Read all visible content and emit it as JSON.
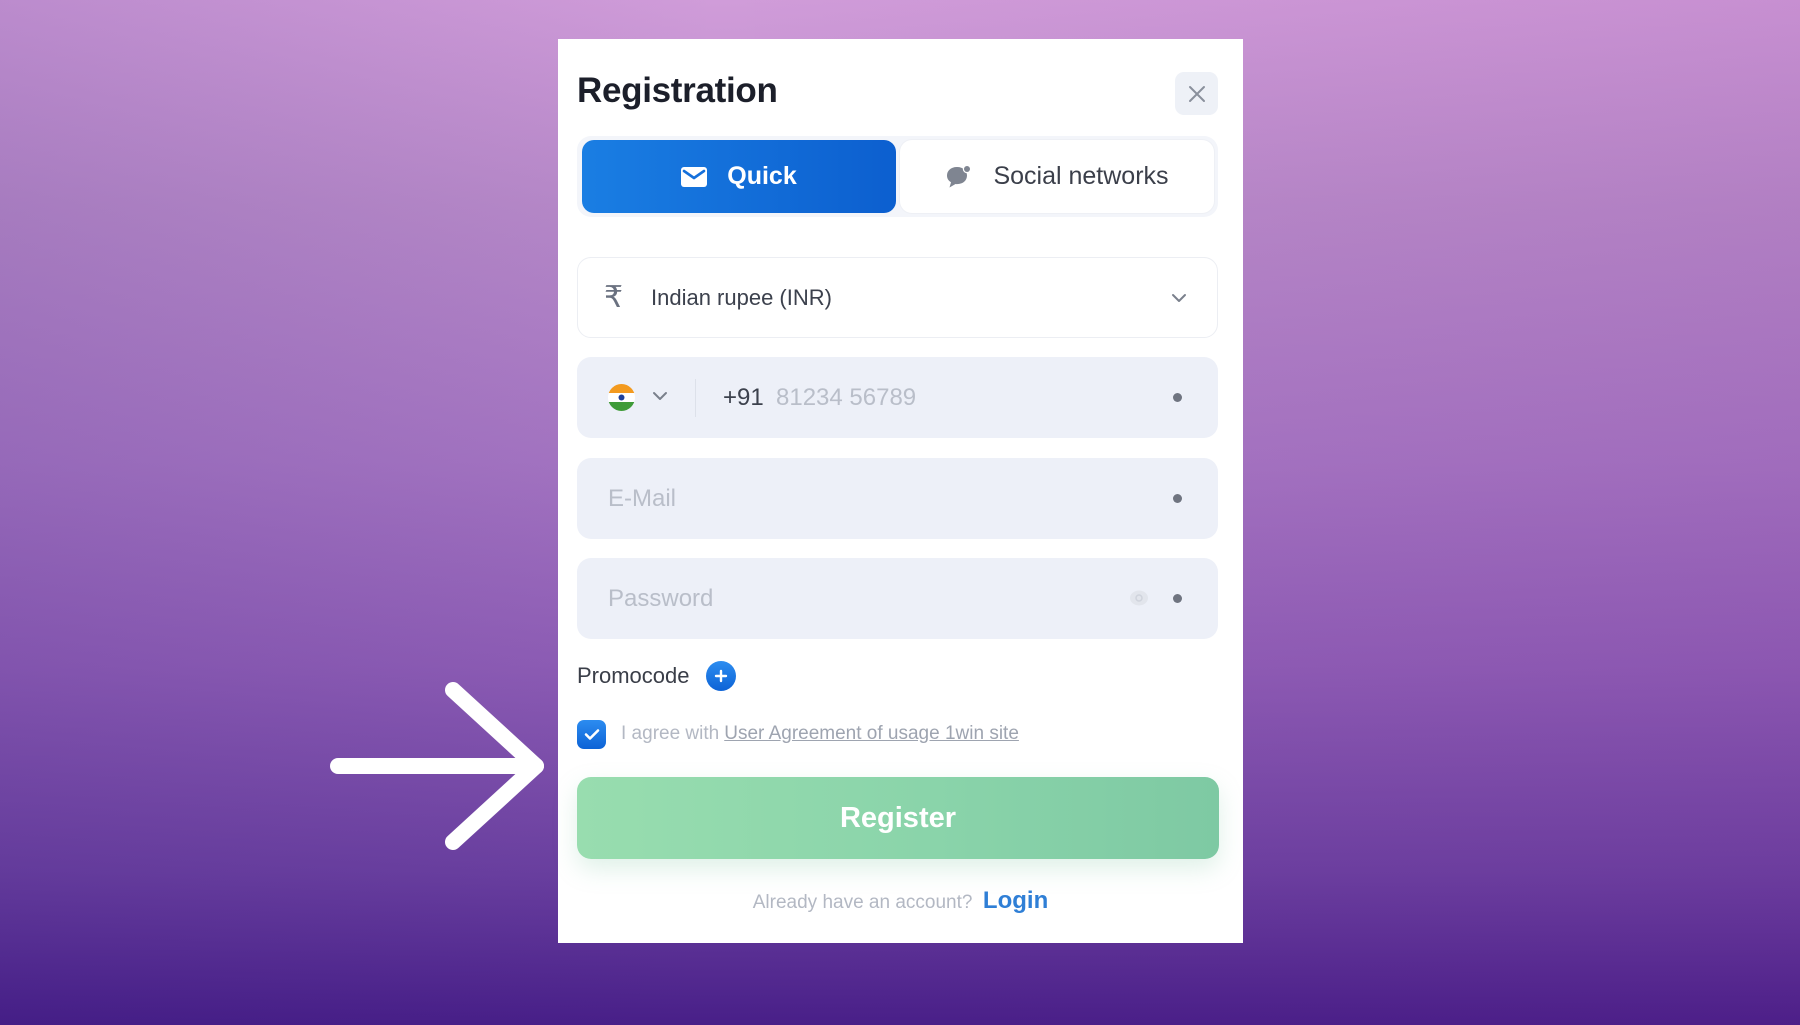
{
  "modal": {
    "title": "Registration",
    "close_icon": "close-icon"
  },
  "tabs": [
    {
      "label": "Quick",
      "icon": "envelope-icon",
      "active": true
    },
    {
      "label": "Social networks",
      "icon": "chat-bubble-icon",
      "active": false
    }
  ],
  "form": {
    "currency": {
      "icon": "rupee-icon",
      "symbol": "₹",
      "selected": "Indian rupee (INR)"
    },
    "phone": {
      "country_flag": "india-flag-icon",
      "prefix": "+91",
      "value": "",
      "placeholder": "81234 56789",
      "required": true
    },
    "email": {
      "value": "",
      "placeholder": "E-Mail",
      "required": true
    },
    "password": {
      "value": "",
      "placeholder": "Password",
      "required": true,
      "visibility_icon": "eye-icon"
    },
    "promocode": {
      "label": "Promocode",
      "icon": "plus-icon"
    },
    "agreement": {
      "checked": true,
      "text": "I agree with",
      "link_text": "User Agreement of usage 1win site"
    },
    "register_label": "Register"
  },
  "footer": {
    "text": "Already have an account?",
    "login_label": "Login"
  },
  "annotation": {
    "arrow_icon": "arrow-right-icon"
  },
  "colors": {
    "primary_blue": "#0c5fcf",
    "register_green": "#8ad4aa",
    "login_link": "#2f7fd6",
    "field_bg": "#edf0f8",
    "background_top": "#d09cd9",
    "background_bottom": "#481f88"
  }
}
